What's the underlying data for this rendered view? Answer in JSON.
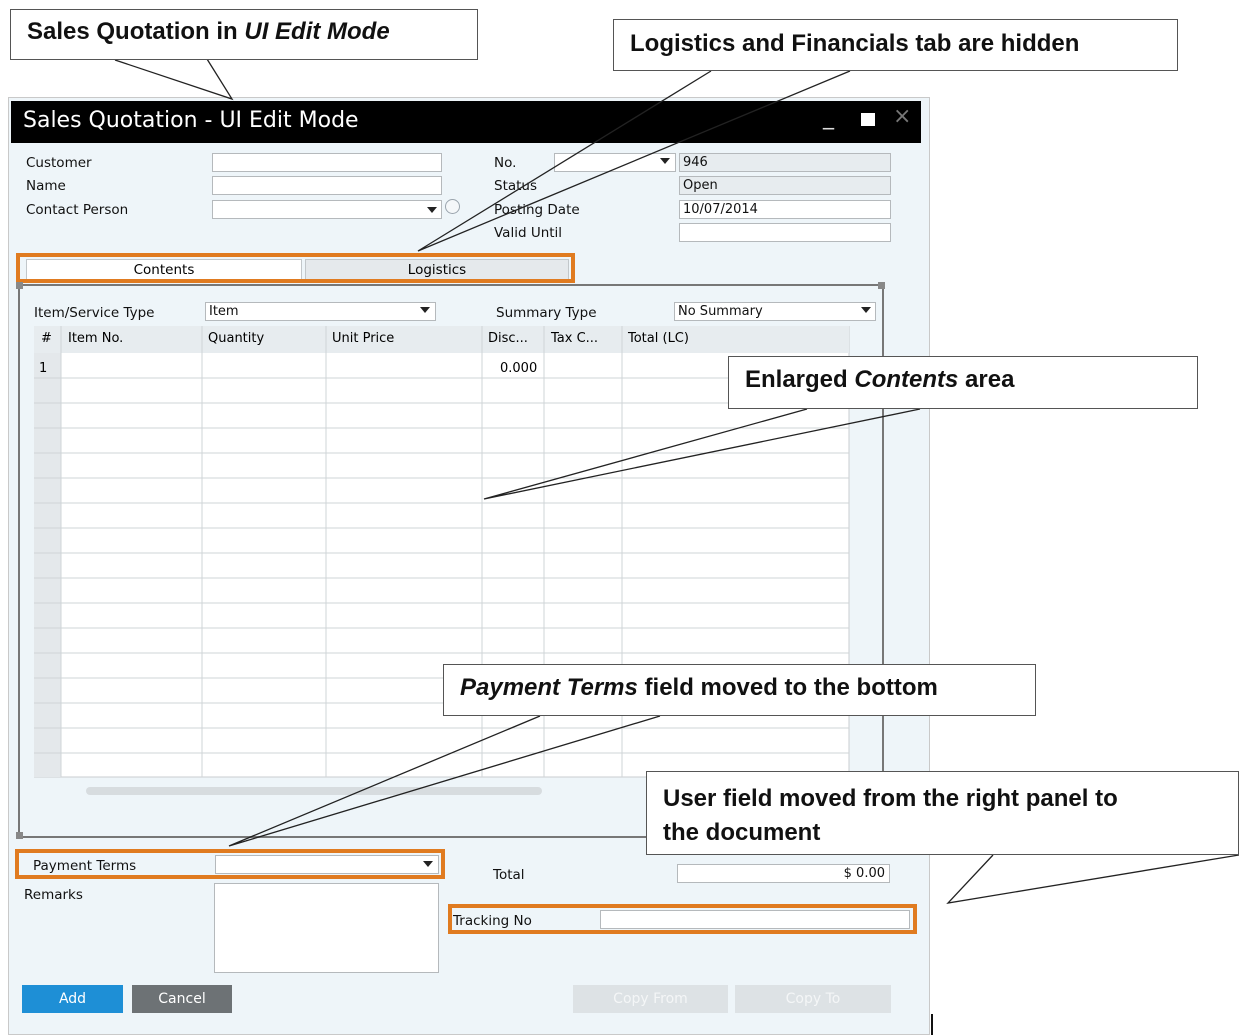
{
  "window": {
    "title": "Sales Quotation - UI Edit Mode",
    "controls": {
      "minimize": "_",
      "close": "×"
    }
  },
  "header": {
    "left": {
      "customer_label": "Customer",
      "name_label": "Name",
      "contact_label": "Contact Person"
    },
    "right": {
      "no_label": "No.",
      "no_series_value": "",
      "no_value": "946",
      "status_label": "Status",
      "status_value": "Open",
      "posting_label": "Posting Date",
      "posting_value": "10/07/2014",
      "valid_label": "Valid Until",
      "valid_value": ""
    }
  },
  "tabs": [
    {
      "label": "Contents"
    },
    {
      "label": "Logistics"
    }
  ],
  "contents": {
    "item_type_label": "Item/Service Type",
    "item_type_value": "Item",
    "summary_label": "Summary Type",
    "summary_value": "No Summary",
    "columns": [
      "#",
      "Item No.",
      "Quantity",
      "Unit Price",
      "Disc...",
      "Tax C...",
      "Total (LC)"
    ],
    "first_row": {
      "num": "1",
      "discount": "0.000"
    }
  },
  "footer": {
    "payment_terms_label": "Payment Terms",
    "remarks_label": "Remarks",
    "total_label": "Total",
    "total_value": "$ 0.00",
    "tracking_label": "Tracking No"
  },
  "buttons": {
    "add": "Add",
    "cancel": "Cancel",
    "copy_from": "Copy From",
    "copy_to": "Copy To"
  },
  "callouts": {
    "c1_prefix": "Sales Quotation in ",
    "c1_italic": "UI Edit Mode",
    "c2": "Logistics and Financials tab are hidden",
    "c3_prefix": "Enlarged ",
    "c3_italic": "Contents",
    "c3_suffix": " area",
    "c4_italic": "Payment Terms",
    "c4_suffix": " field moved to the bottom",
    "c5_line1": "User field moved from the right panel to",
    "c5_line2": "the document"
  },
  "colors": {
    "highlight": "#e07b20",
    "add_button": "#1e8fd6",
    "cancel_button": "#6d7275",
    "disabled_button": "#dde2e5",
    "titlebar": "#000000",
    "window_bg": "#eef5f9"
  }
}
